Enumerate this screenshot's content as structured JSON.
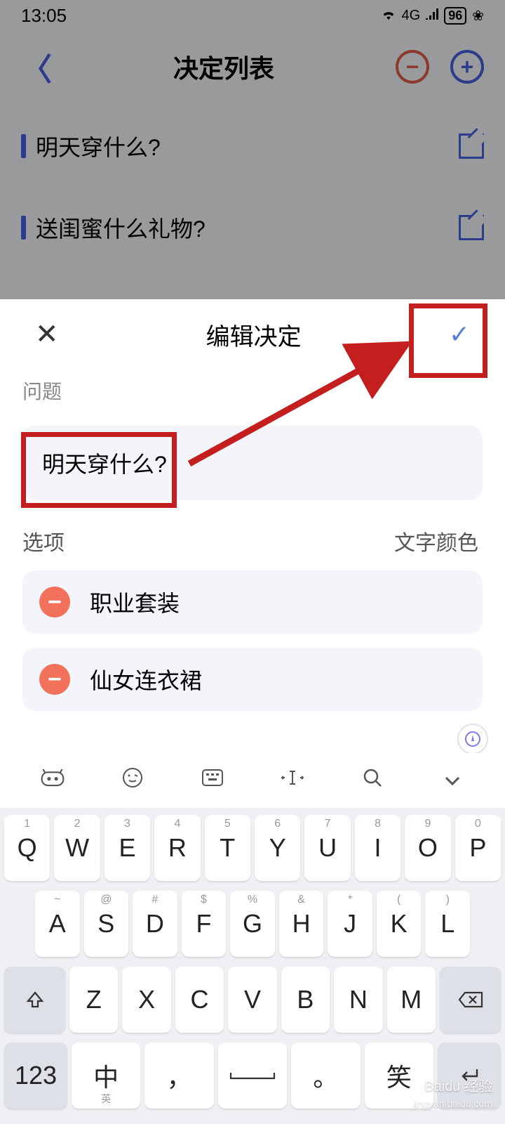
{
  "status_bar": {
    "time": "13:05",
    "network": "4G",
    "battery": "96"
  },
  "background": {
    "title": "决定列表",
    "items": [
      {
        "text": "明天穿什么?"
      },
      {
        "text": "送闺蜜什么礼物?"
      }
    ]
  },
  "sheet": {
    "title": "编辑决定",
    "question_label": "问题",
    "question_value": "明天穿什么?",
    "options_label": "选项",
    "color_label": "文字颜色",
    "options": [
      {
        "text": "职业套装"
      },
      {
        "text": "仙女连衣裙"
      }
    ]
  },
  "keyboard": {
    "row1": [
      {
        "k": "Q",
        "s": "1"
      },
      {
        "k": "W",
        "s": "2"
      },
      {
        "k": "E",
        "s": "3"
      },
      {
        "k": "R",
        "s": "4"
      },
      {
        "k": "T",
        "s": "5"
      },
      {
        "k": "Y",
        "s": "6"
      },
      {
        "k": "U",
        "s": "7"
      },
      {
        "k": "I",
        "s": "8"
      },
      {
        "k": "O",
        "s": "9"
      },
      {
        "k": "P",
        "s": "0"
      }
    ],
    "row2": [
      {
        "k": "A",
        "s": "~"
      },
      {
        "k": "S",
        "s": "@"
      },
      {
        "k": "D",
        "s": "#"
      },
      {
        "k": "F",
        "s": "$"
      },
      {
        "k": "G",
        "s": "%"
      },
      {
        "k": "H",
        "s": "&"
      },
      {
        "k": "J",
        "s": "*"
      },
      {
        "k": "K",
        "s": "("
      },
      {
        "k": "L",
        "s": ")"
      }
    ],
    "row3": [
      {
        "k": "Z"
      },
      {
        "k": "X"
      },
      {
        "k": "C"
      },
      {
        "k": "V"
      },
      {
        "k": "B"
      },
      {
        "k": "N"
      },
      {
        "k": "M"
      }
    ],
    "bottom": {
      "num": "123",
      "lang_main": "中",
      "lang_sub": "英",
      "comma": "，",
      "period": "。",
      "emoji": "笑"
    }
  },
  "watermark": {
    "brand": "Baidu 经验",
    "url": "jingyan.baidu.com"
  }
}
